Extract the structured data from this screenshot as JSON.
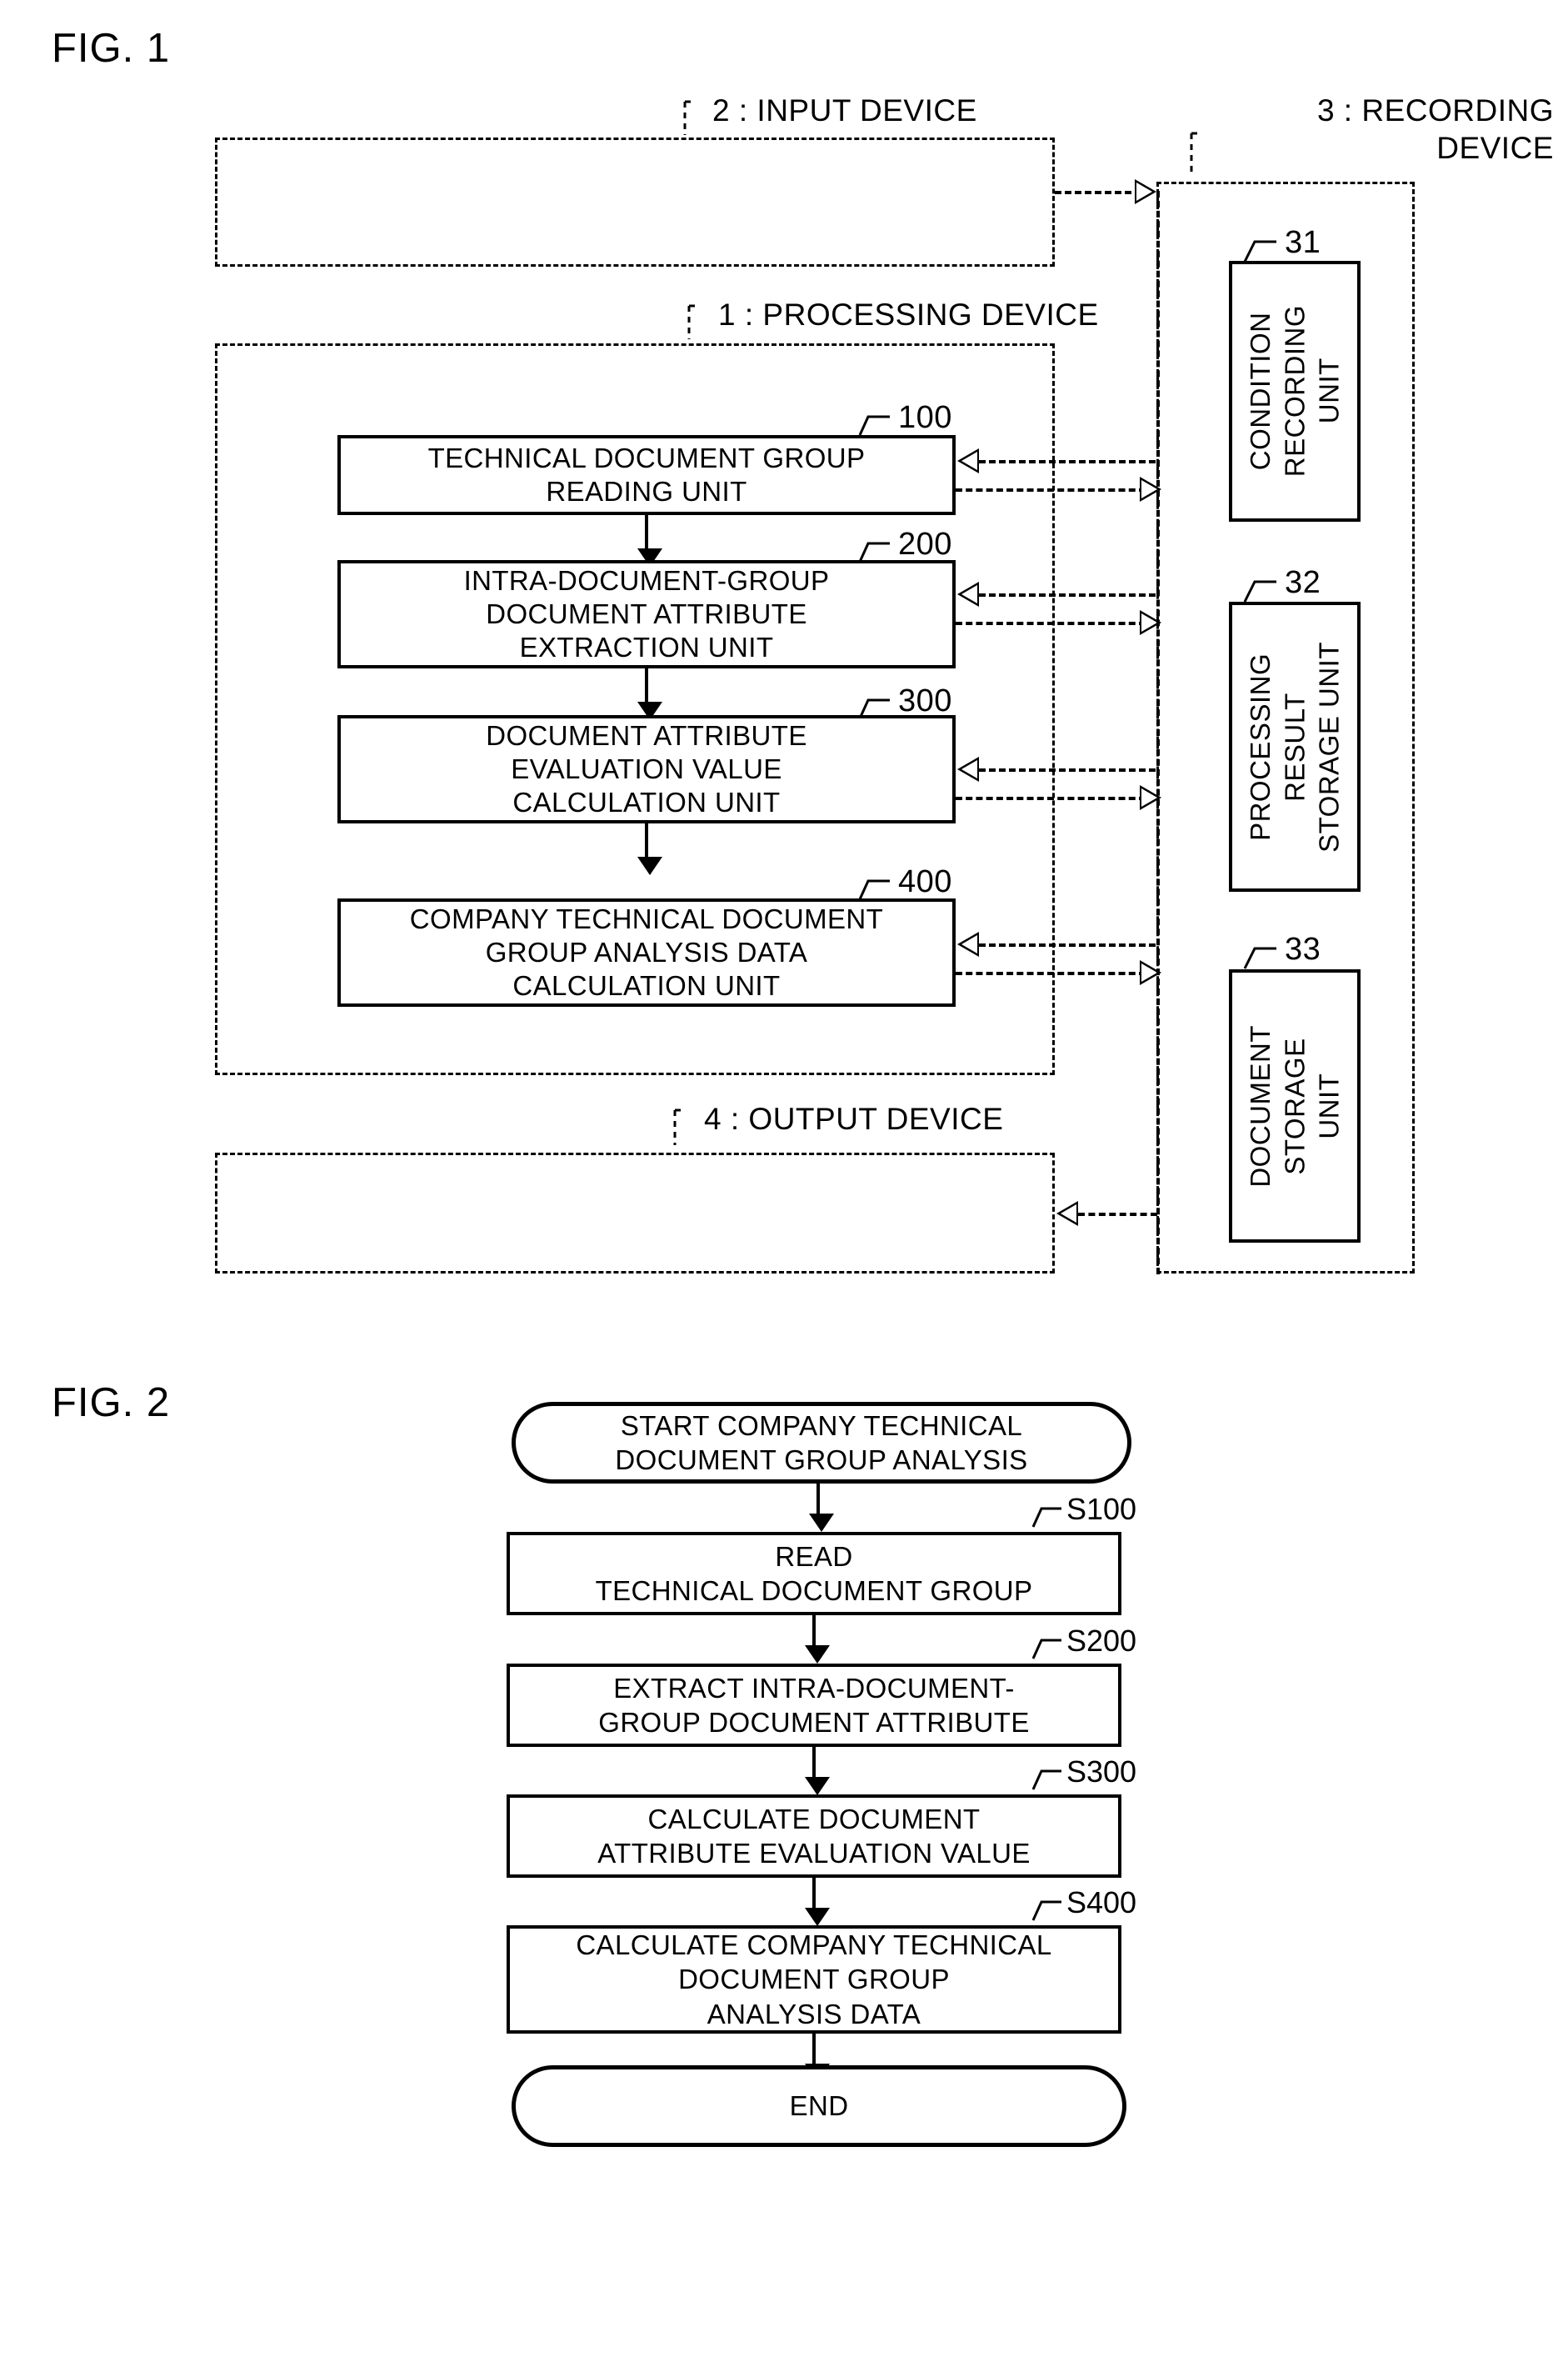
{
  "figures": [
    {
      "id": "fig1",
      "label": "FIG. 1"
    },
    {
      "id": "fig2",
      "label": "FIG. 2"
    }
  ],
  "fig1": {
    "label": "FIG. 1",
    "containers": [
      {
        "ref": "2",
        "name": "input-device",
        "label": "2 : INPUT DEVICE"
      },
      {
        "ref": "1",
        "name": "processing-device",
        "label": "1 : PROCESSING DEVICE"
      },
      {
        "ref": "4",
        "name": "output-device",
        "label": "4 : OUTPUT DEVICE"
      },
      {
        "ref": "3",
        "name": "recording-device",
        "label_line1": "3 : RECORDING",
        "label_line2": "DEVICE"
      }
    ],
    "processing_units": [
      {
        "ref": "100",
        "name": "technical-document-group-reading-unit",
        "lines": [
          "TECHNICAL DOCUMENT GROUP",
          "READING UNIT"
        ]
      },
      {
        "ref": "200",
        "name": "intra-document-group-document-attribute-extraction-unit",
        "lines": [
          "INTRA-DOCUMENT-GROUP",
          "DOCUMENT ATTRIBUTE",
          "EXTRACTION UNIT"
        ]
      },
      {
        "ref": "300",
        "name": "document-attribute-evaluation-value-calculation-unit",
        "lines": [
          "DOCUMENT ATTRIBUTE",
          "EVALUATION VALUE",
          "CALCULATION UNIT"
        ]
      },
      {
        "ref": "400",
        "name": "company-technical-document-group-analysis-data-calculation-unit",
        "lines": [
          "COMPANY TECHNICAL DOCUMENT",
          "GROUP ANALYSIS DATA",
          "CALCULATION UNIT"
        ]
      }
    ],
    "recording_units": [
      {
        "ref": "31",
        "name": "condition-recording-unit",
        "text": "CONDITION\nRECORDING\nUNIT"
      },
      {
        "ref": "32",
        "name": "processing-result-storage-unit",
        "text": "PROCESSING\nRESULT\nSTORAGE UNIT"
      },
      {
        "ref": "33",
        "name": "document-storage-unit",
        "text": "DOCUMENT\nSTORAGE\nUNIT"
      }
    ]
  },
  "fig2": {
    "label": "FIG. 2",
    "start": {
      "name": "start-terminal",
      "lines": [
        "START COMPANY TECHNICAL",
        "DOCUMENT GROUP ANALYSIS"
      ]
    },
    "steps": [
      {
        "ref": "S100",
        "name": "step-read-technical-document-group",
        "lines": [
          "READ",
          "TECHNICAL DOCUMENT GROUP"
        ]
      },
      {
        "ref": "S200",
        "name": "step-extract-intra-document-group-document-attribute",
        "lines": [
          "EXTRACT INTRA-DOCUMENT-",
          "GROUP DOCUMENT ATTRIBUTE"
        ]
      },
      {
        "ref": "S300",
        "name": "step-calculate-document-attribute-evaluation-value",
        "lines": [
          "CALCULATE DOCUMENT",
          "ATTRIBUTE EVALUATION VALUE"
        ]
      },
      {
        "ref": "S400",
        "name": "step-calculate-company-technical-document-group-analysis-data",
        "lines": [
          "CALCULATE COMPANY TECHNICAL",
          "DOCUMENT GROUP",
          "ANALYSIS DATA"
        ]
      }
    ],
    "end": {
      "name": "end-terminal",
      "lines": [
        "END"
      ]
    }
  },
  "colors": {
    "ink": "#000000",
    "paper": "#ffffff"
  }
}
